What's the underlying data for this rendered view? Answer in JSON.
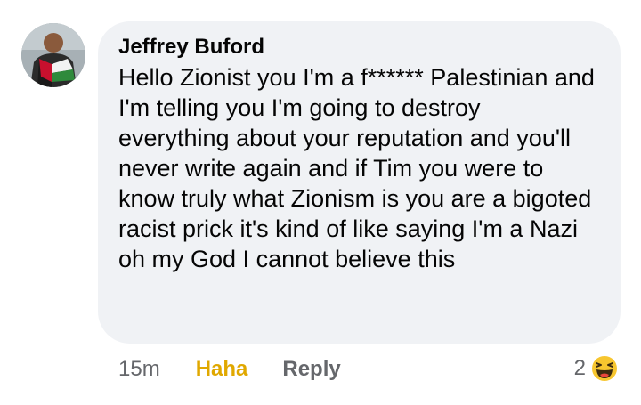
{
  "comment": {
    "author": "Jeffrey Buford",
    "text": "Hello Zionist you I'm a f****** Palestinian and I'm telling you I'm going to destroy everything about your reputation and you'll never write again and if Tim you were to know truly what Zionism is you are a bigoted racist prick it's kind of like saying I'm a Nazi oh my God I cannot believe this",
    "timestamp": "15m",
    "reaction_label": "Haha",
    "reply_label": "Reply",
    "reaction_count": "2",
    "reaction_icon": "haha-emoji-icon"
  },
  "colors": {
    "bubble_bg": "#f0f2f5",
    "text": "#050505",
    "meta": "#65676b",
    "haha_accent": "#e0a800"
  }
}
